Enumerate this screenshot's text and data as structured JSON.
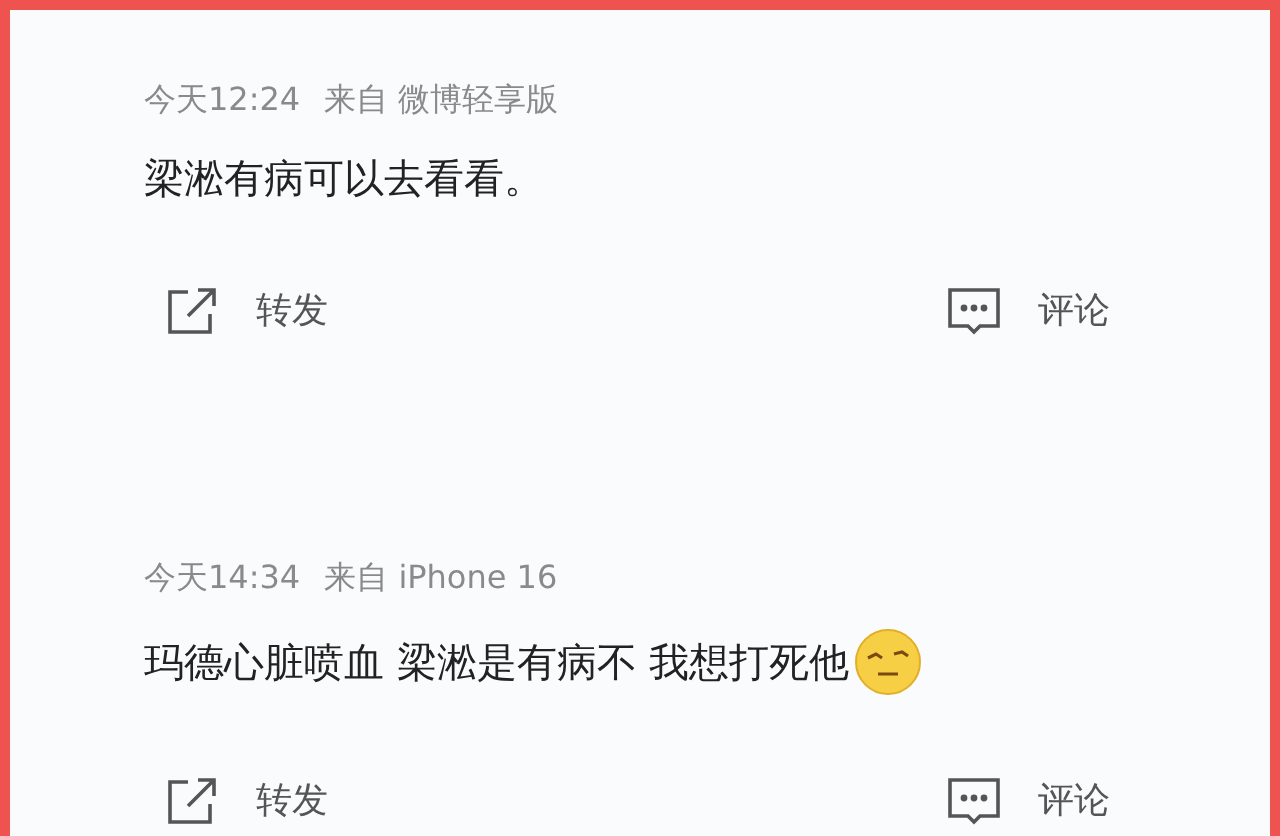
{
  "posts": [
    {
      "time": "今天12:24",
      "source": "来自 微博轻享版",
      "text": "梁淞有病可以去看看。",
      "emoji": false,
      "actions": [
        {
          "kind": "forward",
          "label": "转发"
        },
        {
          "kind": "comment",
          "label": "评论"
        }
      ]
    },
    {
      "time": "今天14:34",
      "source": "来自 iPhone 16",
      "text": "玛德心脏喷血 梁淞是有病不 我想打死他",
      "emoji": true,
      "actions": [
        {
          "kind": "forward",
          "label": "转发"
        },
        {
          "kind": "comment",
          "label": "评论"
        }
      ]
    }
  ]
}
